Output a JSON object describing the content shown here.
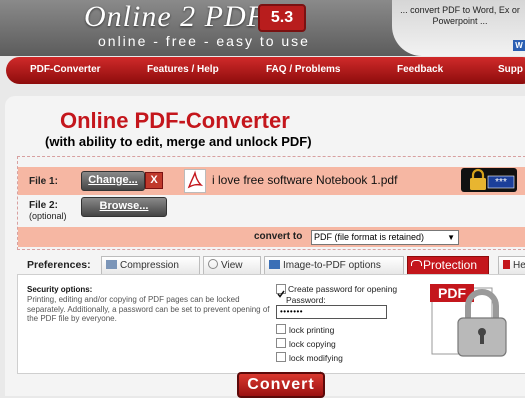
{
  "header": {
    "logo": "Online 2 PDF",
    "version": "5.3",
    "tagline": "online - free - easy to use",
    "promo": "... convert PDF to Word, Ex or Powerpoint ..."
  },
  "nav": [
    "PDF-Converter",
    "Features / Help",
    "FAQ / Problems",
    "Feedback",
    "Supp"
  ],
  "main": {
    "title": "Online PDF-Converter",
    "subtitle": "(with ability to edit, merge and unlock PDF)"
  },
  "files": {
    "file1_label": "File 1:",
    "change_button": "Change...",
    "remove_button": "X",
    "file1_name": "i love free software Notebook 1.pdf",
    "lock_stars": "***",
    "file2_label": "File 2:",
    "file2_optional": "(optional)",
    "browse_button": "Browse...",
    "convert_to_label": "convert to",
    "convert_to_value": "PDF (file format is retained)"
  },
  "preferences": {
    "label": "Preferences:",
    "tabs": [
      "Compression",
      "View",
      "Image-to-PDF options",
      "Protection",
      "He"
    ],
    "active_tab": "Protection"
  },
  "security": {
    "title": "Security options:",
    "description": "Printing, editing and/or copying of PDF pages can be locked separately. Additionally, a password can be set to prevent opening of the PDF file by everyone.",
    "create_password_label": "Create password for opening",
    "create_password_checked": true,
    "password_label": "Password:",
    "password_value": "•••••••",
    "lock_printing": "lock printing",
    "lock_copying": "lock copying",
    "lock_modifying": "lock modifying",
    "graphic_label": "PDF"
  },
  "convert_button": "Convert",
  "colors": {
    "brand_red": "#c4161c",
    "file_row": "#f6b7a3"
  }
}
